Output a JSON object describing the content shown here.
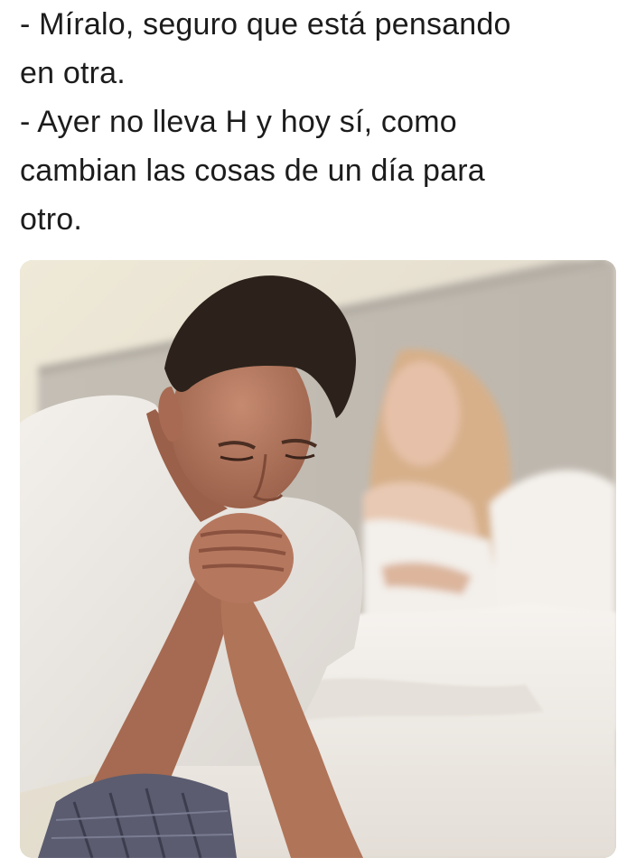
{
  "caption": {
    "lines": [
      "- Míralo, seguro que está pensando",
      "en otra.",
      "- Ayer no lleva H y hoy sí, como",
      "cambian las cosas de un día para",
      "otro."
    ]
  },
  "photo": {
    "colors": {
      "wall": "#e9e2d0",
      "headboard": "#c9c2b8",
      "sheets": "#f2efea",
      "shirt": "#eeeae6",
      "skin": "#b5785f",
      "hair_man": "#2e241d",
      "hair_woman": "#d9b48c",
      "shorts": "#5a5b6e"
    }
  }
}
